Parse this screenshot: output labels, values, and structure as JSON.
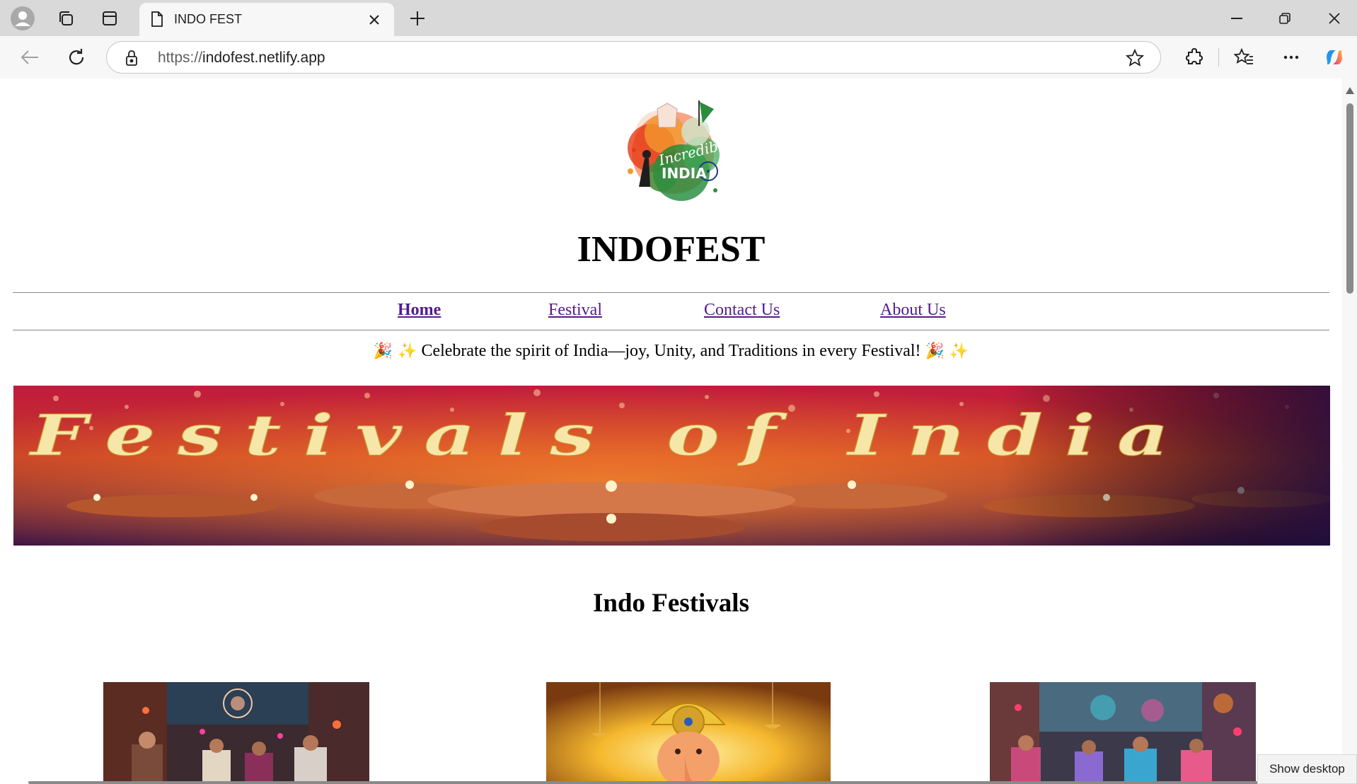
{
  "browser": {
    "tab_title": "INDO FEST",
    "url_scheme": "https://",
    "url_host": "indofest.netlify.app",
    "show_desktop_label": "Show desktop"
  },
  "site": {
    "title": "INDOFEST",
    "logo_text_line1": "Incredible",
    "logo_text_line2": "INDIA",
    "nav": [
      {
        "label": "Home",
        "active": true
      },
      {
        "label": "Festival",
        "active": false
      },
      {
        "label": "Contact Us",
        "active": false
      },
      {
        "label": "About Us",
        "active": false
      }
    ],
    "tagline": {
      "emoji_left": "🎉 ✨",
      "text": "Celebrate the spirit of India—joy, Unity, and Traditions in every Festival!",
      "emoji_right": "🎉 ✨"
    },
    "banner_text": "Festivals of India",
    "section_title": "Indo Festivals"
  },
  "colors": {
    "link": "#551a8b",
    "tab_strip": "#d9d9d9",
    "toolbar": "#f7f7f7",
    "banner_gold": "#f6e7a8",
    "banner_crimson": "#b11735"
  },
  "icons": [
    "profile-icon",
    "workspaces-icon",
    "tab-actions-icon",
    "page-icon",
    "close-icon",
    "new-tab-icon",
    "minimize-icon",
    "restore-icon",
    "window-close-icon",
    "back-icon",
    "refresh-icon",
    "site-info-icon",
    "favorite-star-icon",
    "extensions-icon",
    "favorites-icon",
    "more-icon",
    "copilot-icon"
  ]
}
